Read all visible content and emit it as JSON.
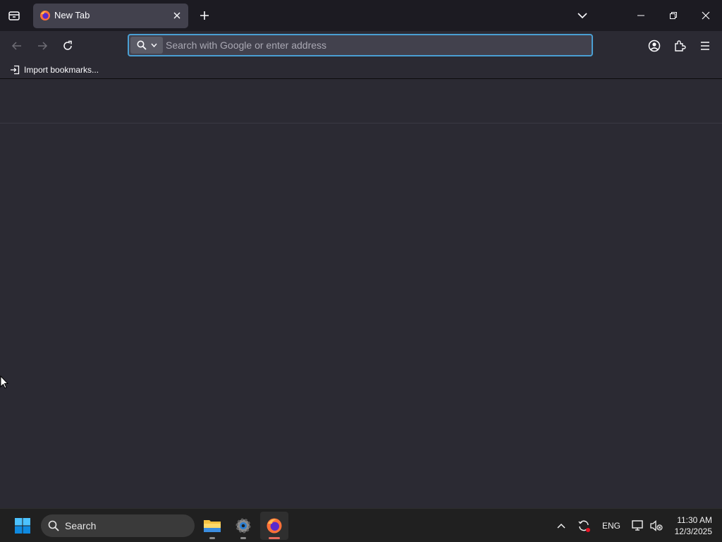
{
  "tabbar": {
    "active_tab": {
      "title": "New Tab"
    }
  },
  "navbar": {
    "urlbar": {
      "placeholder": "Search with Google or enter address",
      "value": ""
    }
  },
  "bookmarks": {
    "items": [
      {
        "label": "Import bookmarks..."
      }
    ]
  },
  "taskbar": {
    "search_label": "Search",
    "apps": [
      {
        "name": "File Explorer"
      },
      {
        "name": "Settings"
      },
      {
        "name": "Firefox"
      }
    ],
    "tray": {
      "language": "ENG"
    },
    "clock": {
      "time": "11:30 AM",
      "date": "12/3/2025"
    }
  },
  "colors": {
    "tabbar_bg": "#1c1b22",
    "toolbar_bg": "#2b2a33",
    "urlbar_bg": "#42414d",
    "focus_ring": "#4a9fd3",
    "taskbar_bg": "#202020"
  }
}
